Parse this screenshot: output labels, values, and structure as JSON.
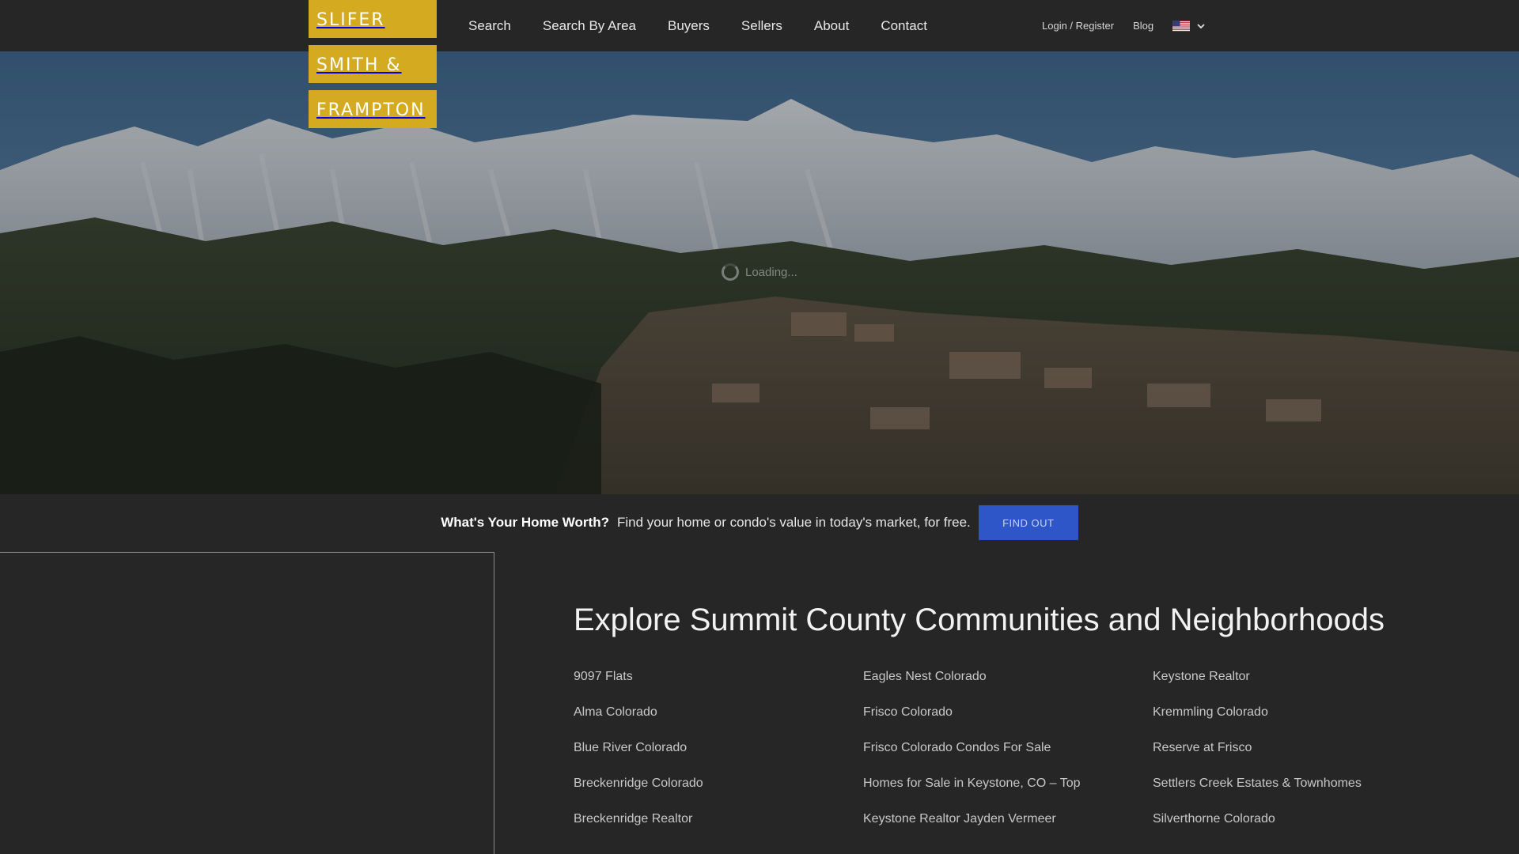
{
  "logo": {
    "lines": [
      "SLIFER",
      "SMITH &",
      "FRAMPTON"
    ],
    "color": "#d4aa20"
  },
  "nav": {
    "items": [
      "Search",
      "Search By Area",
      "Buyers",
      "Sellers",
      "About",
      "Contact"
    ],
    "login": "Login / Register",
    "blog": "Blog",
    "language_icon": "us-flag-icon"
  },
  "hero": {
    "loading_text": "Loading..."
  },
  "cta": {
    "bold": "What's Your Home Worth?",
    "text": "Find your home or condo's value in today's market, for free.",
    "button": "FIND OUT",
    "button_color": "#2f56c8"
  },
  "explore": {
    "title": "Explore Summit County Communities and Neighborhoods",
    "columns": [
      [
        "9097 Flats",
        "Alma Colorado",
        "Blue River Colorado",
        "Breckenridge Colorado",
        "Breckenridge Realtor"
      ],
      [
        "Eagles Nest Colorado",
        "Frisco Colorado",
        "Frisco Colorado Condos For Sale",
        "Homes for Sale in Keystone, CO – Top",
        "Keystone Realtor Jayden Vermeer"
      ],
      [
        "Keystone Realtor",
        "Kremmling Colorado",
        "Reserve at Frisco",
        "Settlers Creek Estates & Townhomes",
        "Silverthorne Colorado"
      ]
    ]
  }
}
